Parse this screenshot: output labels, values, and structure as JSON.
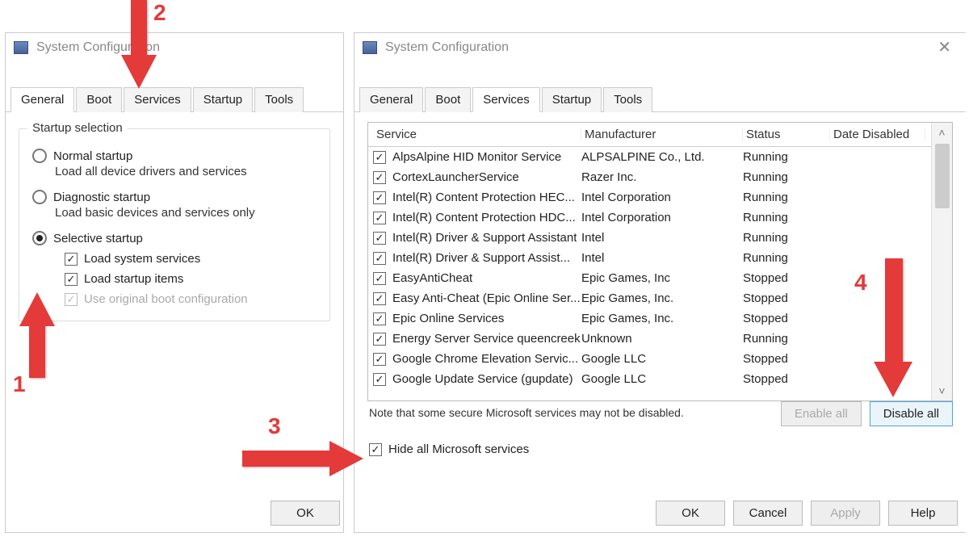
{
  "annotations": {
    "n1": "1",
    "n2": "2",
    "n3": "3",
    "n4": "4"
  },
  "left": {
    "title": "System Configuration",
    "tabs": [
      "General",
      "Boot",
      "Services",
      "Startup",
      "Tools"
    ],
    "active_tab": 0,
    "group_label": "Startup selection",
    "radios": [
      {
        "label": "Normal startup",
        "desc": "Load all device drivers and services",
        "selected": false
      },
      {
        "label": "Diagnostic startup",
        "desc": "Load basic devices and services only",
        "selected": false
      },
      {
        "label": "Selective startup",
        "desc": "",
        "selected": true
      }
    ],
    "checks": [
      {
        "label": "Load system services",
        "checked": true,
        "disabled": false
      },
      {
        "label": "Load startup items",
        "checked": true,
        "disabled": false
      },
      {
        "label": "Use original boot configuration",
        "checked": true,
        "disabled": true
      }
    ],
    "ok_label": "OK"
  },
  "right": {
    "title": "System Configuration",
    "tabs": [
      "General",
      "Boot",
      "Services",
      "Startup",
      "Tools"
    ],
    "active_tab": 2,
    "columns": [
      "Service",
      "Manufacturer",
      "Status",
      "Date Disabled"
    ],
    "rows": [
      {
        "svc": "AlpsAlpine HID Monitor Service",
        "mfr": "ALPSALPINE Co., Ltd.",
        "status": "Running"
      },
      {
        "svc": "CortexLauncherService",
        "mfr": "Razer Inc.",
        "status": "Running"
      },
      {
        "svc": "Intel(R) Content Protection HEC...",
        "mfr": "Intel Corporation",
        "status": "Running"
      },
      {
        "svc": "Intel(R) Content Protection HDC...",
        "mfr": "Intel Corporation",
        "status": "Running"
      },
      {
        "svc": "Intel(R) Driver & Support Assistant",
        "mfr": "Intel",
        "status": "Running"
      },
      {
        "svc": "Intel(R) Driver & Support Assist...",
        "mfr": "Intel",
        "status": "Running"
      },
      {
        "svc": "EasyAntiCheat",
        "mfr": "Epic Games, Inc",
        "status": "Stopped"
      },
      {
        "svc": "Easy Anti-Cheat (Epic Online Ser...",
        "mfr": "Epic Games, Inc.",
        "status": "Stopped"
      },
      {
        "svc": "Epic Online Services",
        "mfr": "Epic Games, Inc.",
        "status": "Stopped"
      },
      {
        "svc": "Energy Server Service queencreek",
        "mfr": "Unknown",
        "status": "Running"
      },
      {
        "svc": "Google Chrome Elevation Servic...",
        "mfr": "Google LLC",
        "status": "Stopped"
      },
      {
        "svc": "Google Update Service (gupdate)",
        "mfr": "Google LLC",
        "status": "Stopped"
      }
    ],
    "note": "Note that some secure Microsoft services may not be disabled.",
    "enable_all": "Enable all",
    "disable_all": "Disable all",
    "hide_ms": "Hide all Microsoft services",
    "hide_ms_checked": true,
    "buttons": {
      "ok": "OK",
      "cancel": "Cancel",
      "apply": "Apply",
      "help": "Help"
    }
  }
}
